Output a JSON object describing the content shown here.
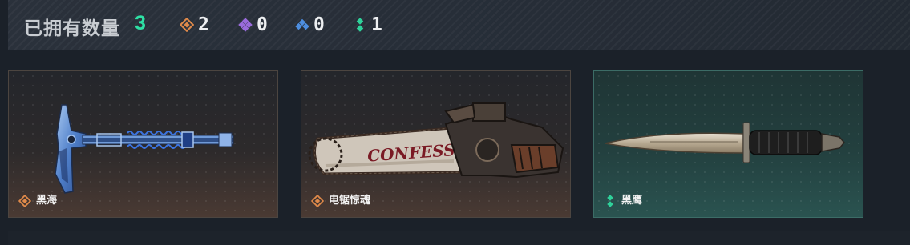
{
  "header": {
    "title": "已拥有数量",
    "total": "3",
    "stats": [
      {
        "icon": "orange-diamond-icon",
        "color": "#e08a4a",
        "count": "2"
      },
      {
        "icon": "purple-diamond-icon",
        "color": "#9a6bdc",
        "count": "0"
      },
      {
        "icon": "blue-diamond-icon",
        "color": "#4d8ee0",
        "count": "0"
      },
      {
        "icon": "green-dots-icon",
        "color": "#2fd19a",
        "count": "1"
      }
    ]
  },
  "cards": [
    {
      "name": "黑海",
      "rarity_icon": "orange-diamond-icon",
      "item": "axe"
    },
    {
      "name": "电锯惊魂",
      "rarity_icon": "orange-diamond-icon",
      "item": "chainsaw",
      "chainsaw_text": "CONFESS"
    },
    {
      "name": "黑鹰",
      "rarity_icon": "green-dots-icon",
      "item": "knife"
    }
  ]
}
